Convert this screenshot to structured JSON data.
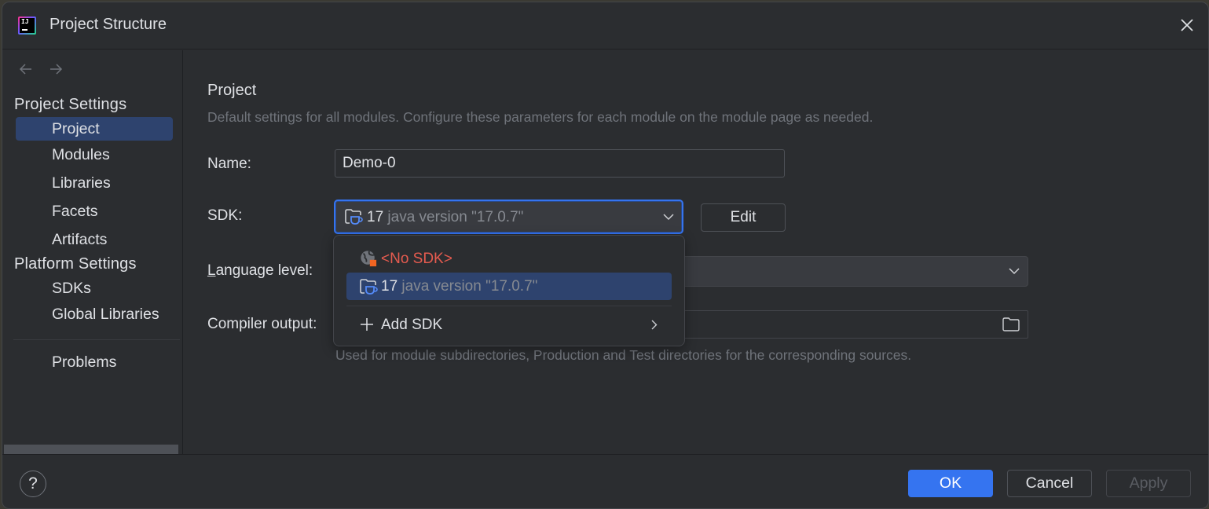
{
  "window": {
    "title": "Project Structure",
    "app_icon_text": "IJ"
  },
  "sidebar": {
    "sections": [
      {
        "header": "Project Settings",
        "items": [
          {
            "label": "Project",
            "selected": true
          },
          {
            "label": "Modules",
            "selected": false
          },
          {
            "label": "Libraries",
            "selected": false
          },
          {
            "label": "Facets",
            "selected": false
          },
          {
            "label": "Artifacts",
            "selected": false
          }
        ]
      },
      {
        "header": "Platform Settings",
        "items": [
          {
            "label": "SDKs",
            "selected": false
          },
          {
            "label": "Global Libraries",
            "selected": false
          }
        ]
      }
    ],
    "extra_items": [
      {
        "label": "Problems"
      }
    ]
  },
  "main": {
    "title": "Project",
    "description": "Default settings for all modules. Configure these parameters for each module on the module page as needed.",
    "name_label": "Name:",
    "name_value": "Demo-0",
    "sdk_label": "SDK:",
    "sdk_selected": {
      "version": "17",
      "description": "java version \"17.0.7\""
    },
    "edit_label": "Edit",
    "language_level_label_mnemonic": "L",
    "language_level_label_rest": "anguage level:",
    "language_level_value": "",
    "compiler_output_label": "Compiler output:",
    "compiler_output_value": "",
    "compiler_output_hint": "Used for module subdirectories, Production and Test directories for the corresponding sources."
  },
  "sdk_popup": {
    "items": [
      {
        "label": "<No SDK>",
        "type": "no-sdk"
      },
      {
        "version": "17",
        "description": "java version \"17.0.7\"",
        "type": "jdk",
        "selected": true
      }
    ],
    "add_label": "Add SDK"
  },
  "footer": {
    "help": "?",
    "ok": "OK",
    "cancel": "Cancel",
    "apply": "Apply"
  },
  "colors": {
    "accent": "#3574f0",
    "selection": "#2e436e",
    "error_text": "#e55b4f",
    "background": "#2b2d30"
  }
}
